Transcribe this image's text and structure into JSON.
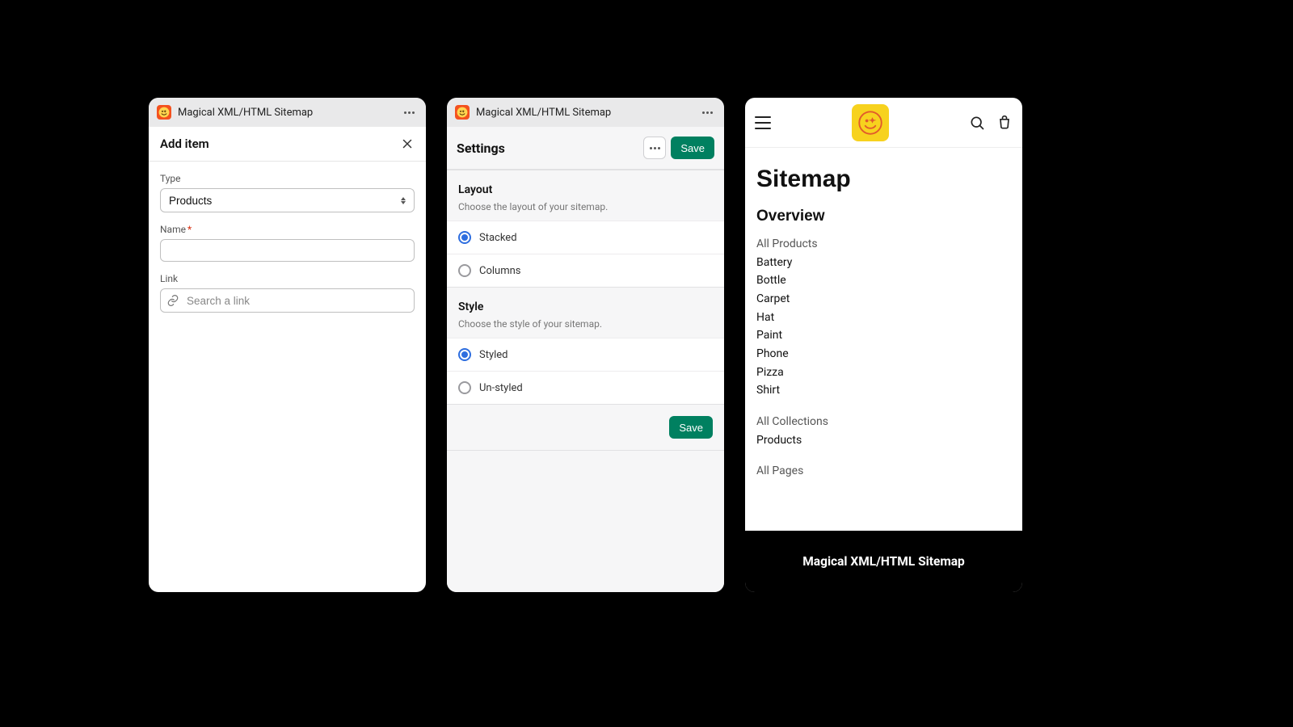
{
  "app": {
    "title": "Magical XML/HTML Sitemap",
    "icon": "smiley-star-icon"
  },
  "panel1": {
    "title": "Add item",
    "fields": {
      "type_label": "Type",
      "type_value": "Products",
      "name_label": "Name",
      "link_label": "Link",
      "link_placeholder": "Search a link"
    }
  },
  "panel2": {
    "title": "Settings",
    "save_label": "Save",
    "sections": {
      "layout": {
        "title": "Layout",
        "subtitle": "Choose the layout of your sitemap.",
        "options": [
          {
            "label": "Stacked",
            "checked": true
          },
          {
            "label": "Columns",
            "checked": false
          }
        ]
      },
      "style": {
        "title": "Style",
        "subtitle": "Choose the style of your sitemap.",
        "options": [
          {
            "label": "Styled",
            "checked": true
          },
          {
            "label": "Un-styled",
            "checked": false
          }
        ]
      }
    },
    "footer_save": "Save"
  },
  "panel3": {
    "title": "Sitemap",
    "overview": "Overview",
    "all_products": "All Products",
    "products": [
      "Battery",
      "Bottle",
      "Carpet",
      "Hat",
      "Paint",
      "Phone",
      "Pizza",
      "Shirt"
    ],
    "all_collections": "All Collections",
    "collections": [
      "Products"
    ],
    "all_pages": "All Pages",
    "footer": "Magical XML/HTML Sitemap"
  }
}
